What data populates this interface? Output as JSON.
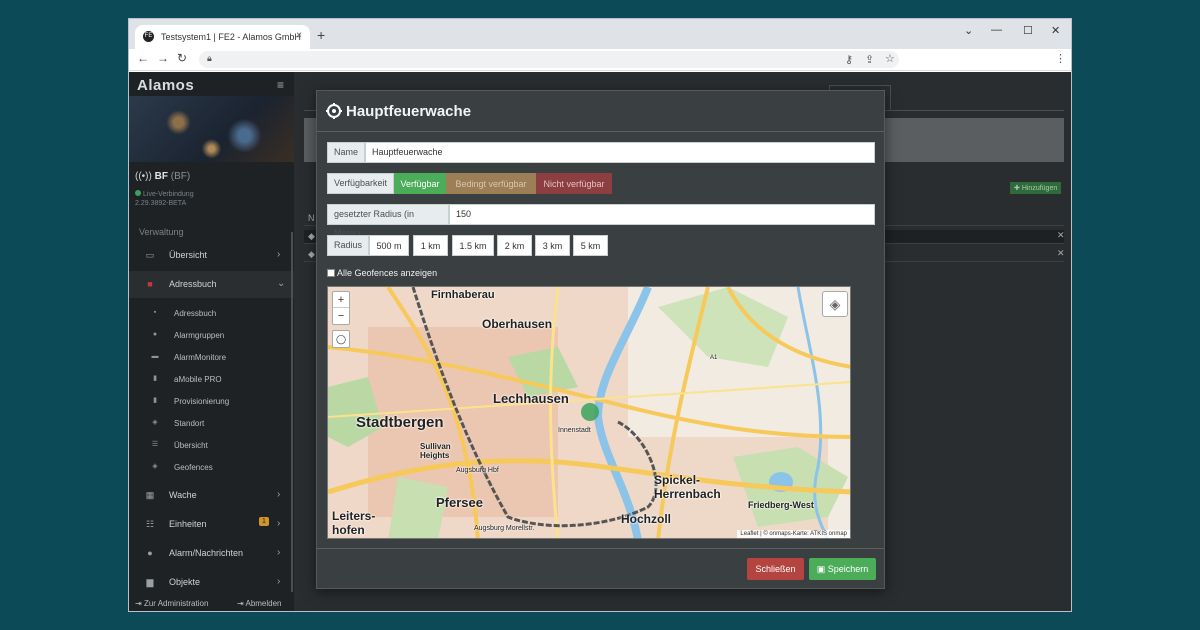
{
  "browser": {
    "tab_title": "Testsystem1 | FE2 - Alamos GmbH",
    "favicon_text": "FE",
    "new_tab_label": "+",
    "close_tab_label": "×"
  },
  "sidebar": {
    "brand": "Alamos",
    "unit_name": "BF",
    "unit_code": "(BF)",
    "connection_status": "Live-Verbindung",
    "version": "2.29.3892-BETA",
    "section_label": "Verwaltung",
    "items": [
      {
        "label": "Übersicht",
        "icon": "monitor-icon"
      },
      {
        "label": "Adressbuch",
        "icon": "book-icon"
      },
      {
        "label": "Wache",
        "icon": "building-icon"
      },
      {
        "label": "Einheiten",
        "icon": "list-icon",
        "badge": "1"
      },
      {
        "label": "Alarm/Nachrichten",
        "icon": "bell-icon"
      },
      {
        "label": "Objekte",
        "icon": "objects-icon"
      }
    ],
    "sub_items": [
      {
        "label": "Adressbuch"
      },
      {
        "label": "Alarmgruppen"
      },
      {
        "label": "AlarmMonitore"
      },
      {
        "label": "aMobile PRO"
      },
      {
        "label": "Provisionierung"
      },
      {
        "label": "Standort"
      },
      {
        "label": "Übersicht"
      },
      {
        "label": "Geofences"
      }
    ],
    "footer_admin": "Zur Administration",
    "footer_logout": "Abmelden"
  },
  "background": {
    "add_button": "Hinzufügen"
  },
  "modal": {
    "title": "Hauptfeuerwache",
    "name_label": "Name",
    "name_value": "Hauptfeuerwache",
    "availability_label": "Verfügbarkeit",
    "availability_options": [
      "Verfügbar",
      "Bedingt verfügbar",
      "Nicht verfügbar"
    ],
    "availability_selected": "Verfügbar",
    "radius_label": "gesetzter Radius (in Meter)",
    "radius_value": "150",
    "radius_presets_label": "Radius",
    "radius_presets": [
      "500 m",
      "1 km",
      "1.5 km",
      "2 km",
      "3 km",
      "5 km"
    ],
    "show_all_geofences_label": "Alle Geofences anzeigen",
    "show_all_geofences_checked": false,
    "close_button": "Schließen",
    "save_button": "Speichern",
    "colors": {
      "accent_green": "#4bac5a",
      "danger_red": "#b5433f",
      "geofence_marker": "#3aa35a"
    }
  },
  "map": {
    "zoom_in": "+",
    "zoom_out": "−",
    "attribution": "Leaflet | © onmaps-Karte: ATKIS onmap",
    "labels": [
      {
        "text": "Firnhaberau",
        "size": 11
      },
      {
        "text": "Oberhausen",
        "size": 12
      },
      {
        "text": "Lechhausen",
        "size": 13
      },
      {
        "text": "Stadtbergen",
        "size": 15
      },
      {
        "text": "Innenstadt",
        "size": 7
      },
      {
        "text": "Sullivan Heights",
        "size": 8
      },
      {
        "text": "Augsburg Hbf",
        "size": 7
      },
      {
        "text": "Pfersee",
        "size": 13
      },
      {
        "text": "Spickel-Herrenbach",
        "size": 12
      },
      {
        "text": "Friedberg-West",
        "size": 9
      },
      {
        "text": "Hochzoll",
        "size": 12
      },
      {
        "text": "Leiters-hofen",
        "size": 12
      },
      {
        "text": "Augsburg Morellstr.",
        "size": 7
      },
      {
        "text": "A1",
        "size": 6
      }
    ]
  }
}
